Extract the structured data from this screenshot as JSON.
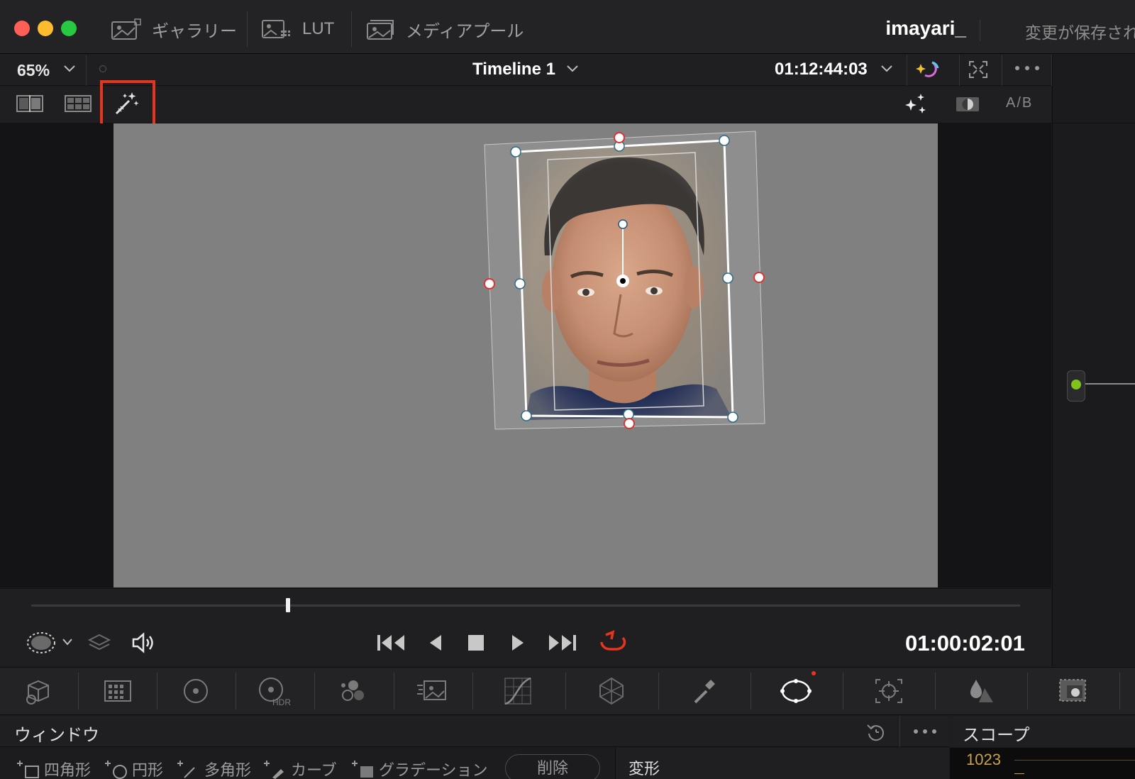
{
  "titlebar": {
    "nav": [
      {
        "label": "ギャラリー",
        "icon": "gallery-icon"
      },
      {
        "label": "LUT",
        "icon": "lut-icon"
      },
      {
        "label": "メディアプール",
        "icon": "media-pool-icon"
      }
    ],
    "project_name": "imayari_",
    "save_status": "変更が保存され"
  },
  "viewer": {
    "zoom": "65%",
    "timeline_name": "Timeline 1",
    "timecode": "01:12:44:03",
    "ab_label": "A/B",
    "highlighted_tool": "magic-mask-icon"
  },
  "transport": {
    "timecode": "01:00:02:01",
    "scrub_position": 0.26
  },
  "palette": {
    "icons": [
      "camera-raw-icon",
      "color-match-icon",
      "primaries-icon",
      "hdr-icon",
      "rgb-mixer-icon",
      "motion-effects-icon",
      "curves-icon",
      "color-warper-icon",
      "qualifier-icon",
      "window-icon",
      "tracker-icon",
      "blur-icon",
      "key-icon"
    ],
    "active": "window-icon"
  },
  "window_panel": {
    "title": "ウィンドウ",
    "shapes": [
      "四角形",
      "円形",
      "多角形",
      "カーブ",
      "グラデーション"
    ],
    "delete_label": "削除",
    "transform_label": "変形"
  },
  "scope_panel": {
    "title": "スコープ",
    "value": "1023"
  },
  "colors": {
    "accent_red": "#e8341c",
    "node_green": "#7fc31c",
    "scope_value": "#c9a24a"
  }
}
